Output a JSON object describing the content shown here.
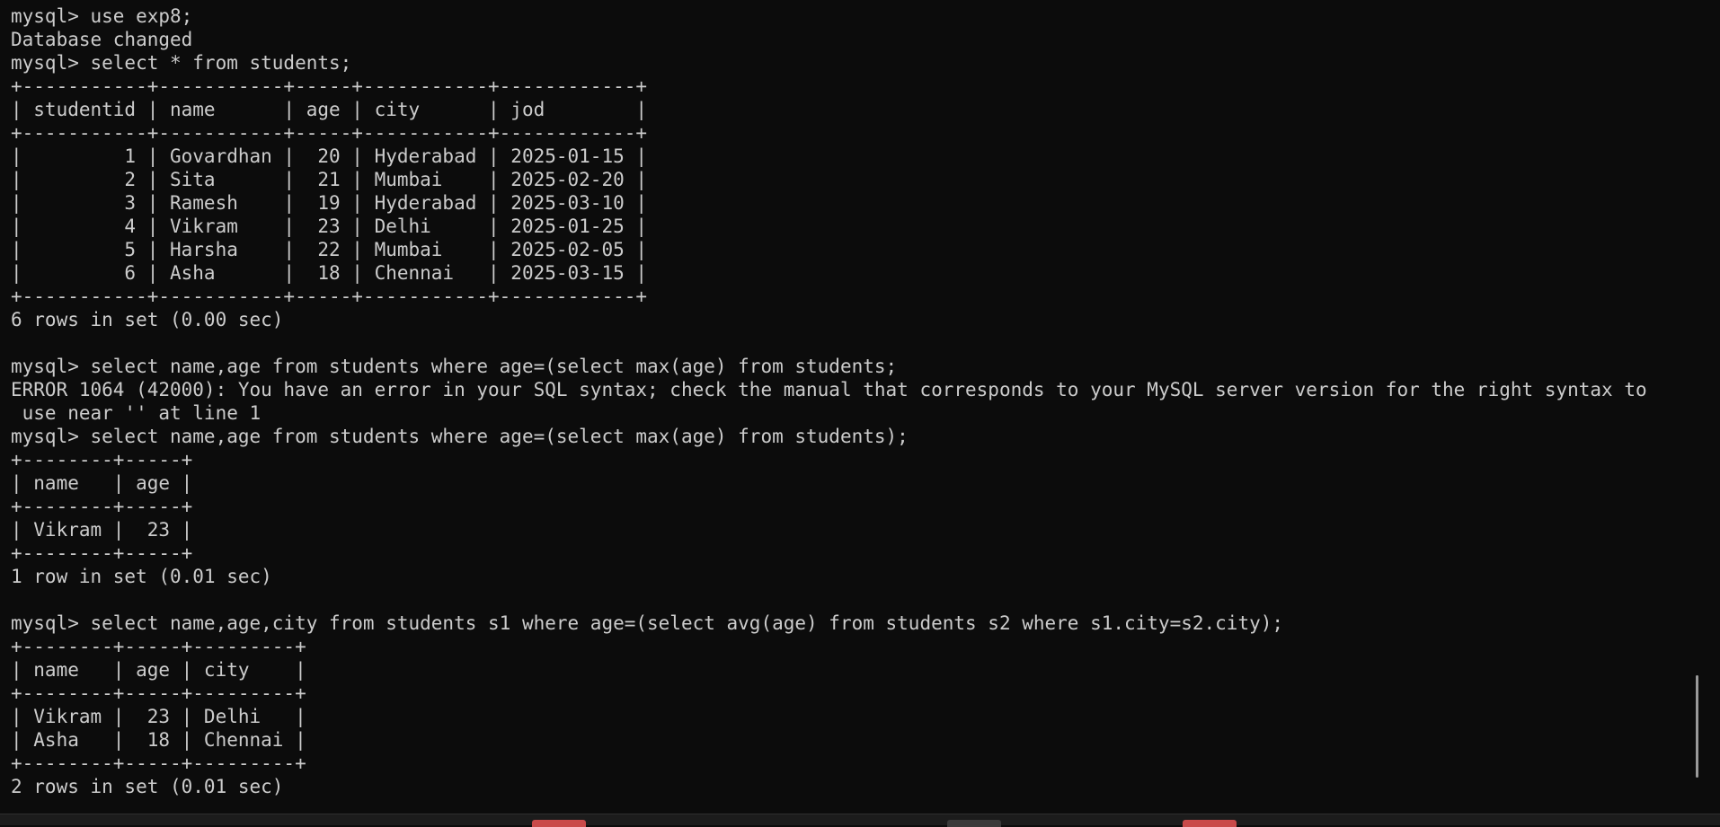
{
  "terminal": {
    "lines": [
      "mysql> use exp8;",
      "Database changed",
      "mysql> select * from students;",
      "+-----------+-----------+-----+-----------+------------+",
      "| studentid | name      | age | city      | jod        |",
      "+-----------+-----------+-----+-----------+------------+",
      "|         1 | Govardhan |  20 | Hyderabad | 2025-01-15 |",
      "|         2 | Sita      |  21 | Mumbai    | 2025-02-20 |",
      "|         3 | Ramesh    |  19 | Hyderabad | 2025-03-10 |",
      "|         4 | Vikram    |  23 | Delhi     | 2025-01-25 |",
      "|         5 | Harsha    |  22 | Mumbai    | 2025-02-05 |",
      "|         6 | Asha      |  18 | Chennai   | 2025-03-15 |",
      "+-----------+-----------+-----+-----------+------------+",
      "6 rows in set (0.00 sec)",
      "",
      "mysql> select name,age from students where age=(select max(age) from students;",
      "ERROR 1064 (42000): You have an error in your SQL syntax; check the manual that corresponds to your MySQL server version for the right syntax to",
      " use near '' at line 1",
      "mysql> select name,age from students where age=(select max(age) from students);",
      "+--------+-----+",
      "| name   | age |",
      "+--------+-----+",
      "| Vikram |  23 |",
      "+--------+-----+",
      "1 row in set (0.01 sec)",
      "",
      "mysql> select name,age,city from students s1 where age=(select avg(age) from students s2 where s1.city=s2.city);",
      "+--------+-----+---------+",
      "| name   | age | city    |",
      "+--------+-----+---------+",
      "| Vikram |  23 | Delhi   |",
      "| Asha   |  18 | Chennai |",
      "+--------+-----+---------+",
      "2 rows in set (0.01 sec)"
    ]
  },
  "colors": {
    "background": "#0c0c0c",
    "foreground": "#cccccc",
    "scrollbar_thumb": "#9a9a9a",
    "taskbar": "#1c1c1c",
    "taskbar_accent_red": "#c94a4a",
    "taskbar_accent_gray": "#3a3a3a"
  }
}
